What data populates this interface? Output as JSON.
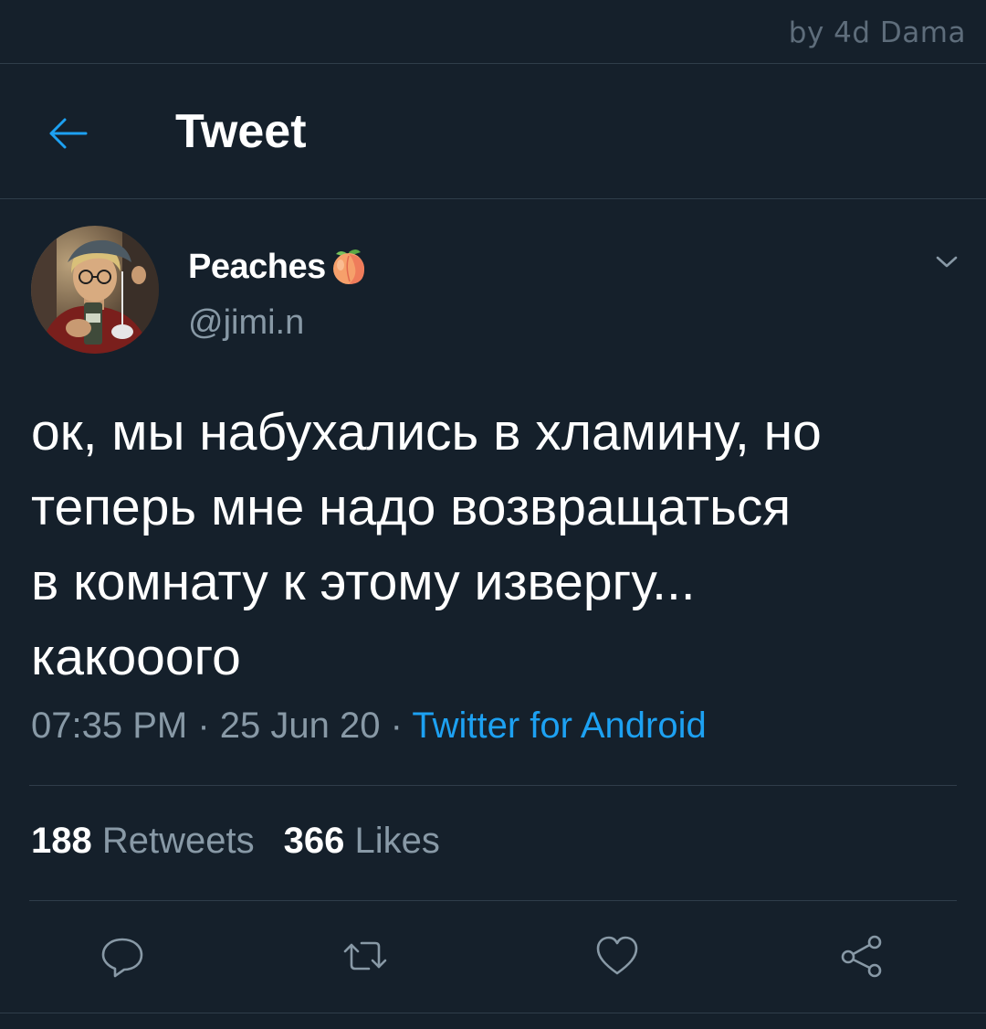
{
  "watermark": "by 4d Dama",
  "header": {
    "title": "Tweet"
  },
  "tweet": {
    "display_name": "Peaches",
    "handle": "@jimi.n",
    "text": "ок, мы набухались в хламину, но\nтеперь мне надо возвращаться\nв комнату к этому извергу...\nкакооого",
    "time": "07:35 PM",
    "date": "25 Jun 20",
    "source": "Twitter for Android",
    "separator": "·"
  },
  "stats": {
    "retweets_count": "188",
    "retweets_label": "Retweets",
    "likes_count": "366",
    "likes_label": "Likes"
  },
  "colors": {
    "background": "#15202b",
    "accent": "#1da1f2",
    "secondary_text": "#8899a6",
    "divider": "#2f3d4a"
  },
  "icons": {
    "back": "arrow-left-icon",
    "caret": "chevron-down-icon",
    "reply": "reply-icon",
    "retweet": "retweet-icon",
    "like": "heart-icon",
    "share": "share-icon",
    "emoji": "peach-emoji"
  }
}
